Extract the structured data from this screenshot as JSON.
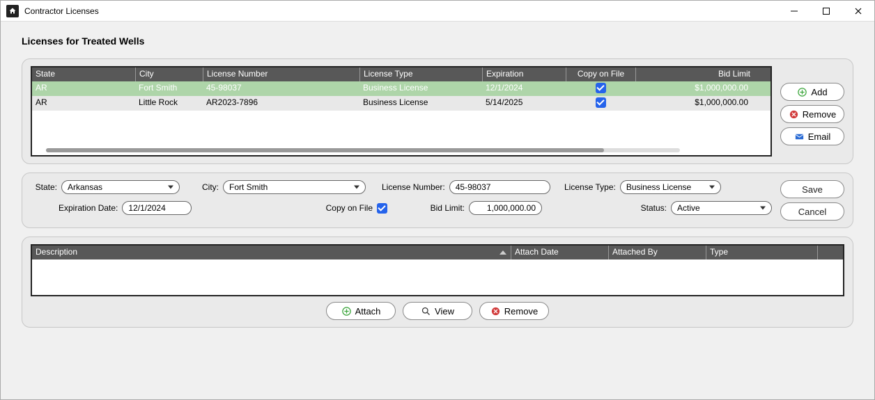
{
  "window": {
    "title": "Contractor Licenses"
  },
  "page": {
    "title": "Licenses for Treated Wells"
  },
  "grid": {
    "headers": {
      "state": "State",
      "city": "City",
      "ln": "License Number",
      "lt": "License Type",
      "exp": "Expiration",
      "cof": "Copy on File",
      "bl": "Bid Limit"
    },
    "rows": [
      {
        "state": "AR",
        "city": "Fort Smith",
        "ln": "45-98037",
        "lt": "Business License",
        "exp": "12/1/2024",
        "cof": true,
        "bl": "$1,000,000.00",
        "selected": true
      },
      {
        "state": "AR",
        "city": "Little Rock",
        "ln": "AR2023-7896",
        "lt": "Business License",
        "exp": "5/14/2025",
        "cof": true,
        "bl": "$1,000,000.00",
        "selected": false
      }
    ]
  },
  "sideButtons": {
    "add": "Add",
    "remove": "Remove",
    "email": "Email"
  },
  "form": {
    "labels": {
      "state": "State:",
      "city": "City:",
      "ln": "License Number:",
      "lt": "License Type:",
      "expd": "Expiration Date:",
      "cof": "Copy on File",
      "bl": "Bid Limit:",
      "status": "Status:"
    },
    "state": "Arkansas",
    "city": "Fort Smith",
    "ln": "45-98037",
    "lt": "Business License",
    "expd": "12/1/2024",
    "cof": true,
    "bl": "1,000,000.00",
    "status": "Active",
    "buttons": {
      "save": "Save",
      "cancel": "Cancel"
    }
  },
  "attachments": {
    "headers": {
      "desc": "Description",
      "ad": "Attach Date",
      "ab": "Attached By",
      "type": "Type"
    },
    "buttons": {
      "attach": "Attach",
      "view": "View",
      "remove": "Remove"
    }
  }
}
